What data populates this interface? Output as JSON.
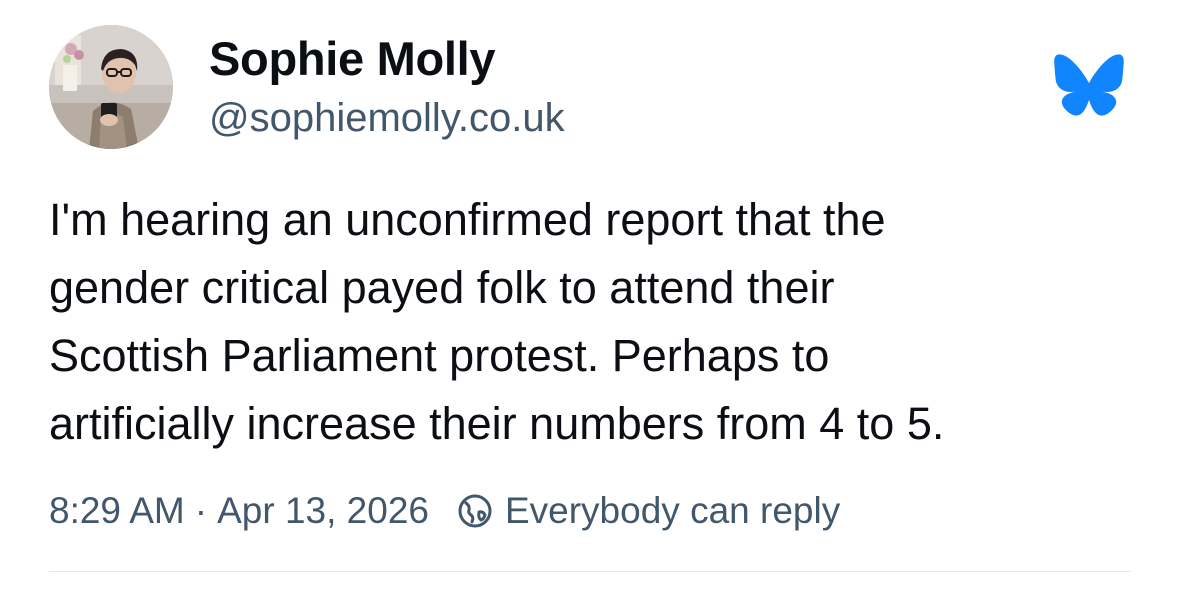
{
  "author": {
    "display_name": "Sophie Molly",
    "handle": "@sophiemolly.co.uk"
  },
  "post": {
    "text_lines": [
      "I'm hearing an unconfirmed report that the",
      "gender critical payed folk to attend their",
      "Scottish Parliament protest. Perhaps to",
      "artificially increase their numbers from 4 to 5."
    ],
    "time": "8:29 AM",
    "separator": "·",
    "date": "Apr 13, 2026",
    "reply_setting": "Everybody can reply"
  },
  "icons": {
    "app_logo": "bluesky-butterfly-icon",
    "reply_setting": "globe-icon"
  },
  "colors": {
    "text_primary": "#0b0f14",
    "text_secondary": "#42576c",
    "brand_blue": "#1185fe",
    "divider": "#e2e7ee"
  }
}
